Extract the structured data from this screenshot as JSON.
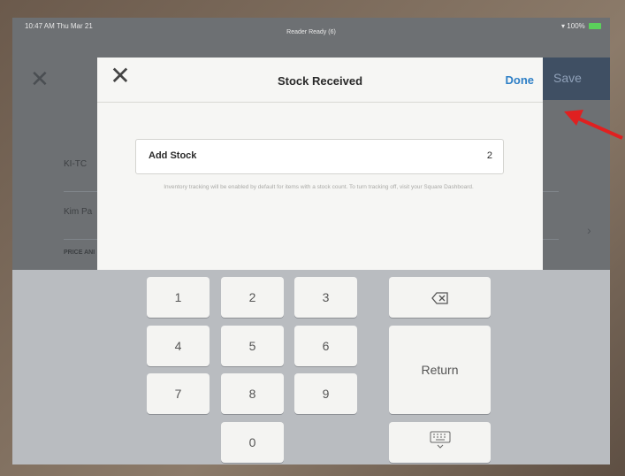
{
  "status_bar": {
    "time": "10:47 AM  Thu Mar 21",
    "reader": "Reader Ready (6)",
    "right": "100%"
  },
  "background": {
    "save_label": "Save",
    "row1_label": "KI-TC",
    "row2_label": "Kim Pa",
    "row3_label": "PRICE ANI"
  },
  "modal": {
    "title": "Stock Received",
    "done_label": "Done",
    "field_label": "Add Stock",
    "field_value": "2",
    "hint": "Inventory tracking will be enabled by default for items with a stock count. To turn tracking off, visit your Square Dashboard."
  },
  "keypad": {
    "keys": [
      "1",
      "2",
      "3",
      "4",
      "5",
      "6",
      "7",
      "8",
      "9",
      "0"
    ],
    "return_label": "Return",
    "backspace_icon": "backspace-icon",
    "dismiss_icon": "keyboard-dismiss-icon"
  },
  "annotation": {
    "arrow_color": "#e02020"
  }
}
